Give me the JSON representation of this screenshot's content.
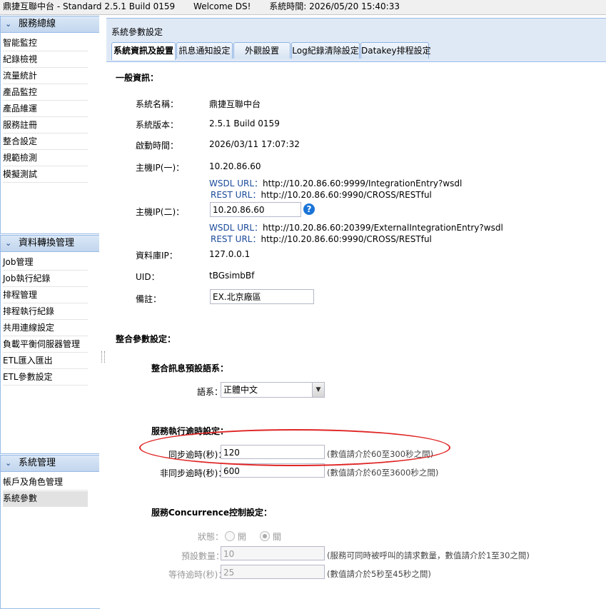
{
  "app": {
    "title": "鼎捷互聯中台 - Standard 2.5.1 Build 0159",
    "welcome": "Welcome DS!",
    "system_time": "系統時間: 2026/05/20 15:40:33"
  },
  "sidebar": {
    "panels": [
      {
        "title": "服務總線",
        "items": [
          "智能監控",
          "紀錄檢視",
          "流量統計",
          "產品監控",
          "產品維運",
          "服務註冊",
          "整合設定",
          "規範檢測",
          "模擬測試"
        ]
      },
      {
        "title": "資料轉換管理",
        "items": [
          "Job管理",
          "Job執行紀錄",
          "排程管理",
          "排程執行紀錄",
          "共用連線設定",
          "負載平衡伺服器管理",
          "ETL匯入匯出",
          "ETL參數設定"
        ]
      },
      {
        "title": "系統管理",
        "items": [
          "帳戶及角色管理",
          "系統參數"
        ],
        "selected": "系統參數"
      }
    ]
  },
  "main": {
    "title": "系統參數設定",
    "tabs": [
      "系統資訊及設置",
      "訊息通知設定",
      "外觀設置",
      "Log紀錄清除設定",
      "Datakey排程設定"
    ],
    "active_tab": "系統資訊及設置"
  },
  "general": {
    "heading": "一般資訊：",
    "system_name_label": "系統名稱：",
    "system_name": "鼎捷互聯中台",
    "version_label": "系統版本：",
    "version": "2.5.1 Build 0159",
    "start_label": "啟動時間：",
    "start_time": "2026/03/11 17:07:32",
    "host1_label": "主機IP(一)：",
    "host1_ip": "10.20.86.60",
    "host1_wsdl_label": "WSDL URL：",
    "host1_wsdl": "http://10.20.86.60:9999/IntegrationEntry?wsdl",
    "host1_rest_label": "REST URL：",
    "host1_rest": "http://10.20.86.60:9990/CROSS/RESTful",
    "host2_label": "主機IP(二)：",
    "host2_ip": "10.20.86.60",
    "host2_wsdl_label": "WSDL URL：",
    "host2_wsdl": "http://10.20.86.60:20399/ExternalIntegrationEntry?wsdl",
    "host2_rest_label": "REST URL：",
    "host2_rest": "http://10.20.86.60:9990/CROSS/RESTful",
    "db_label": "資料庫IP：",
    "db_ip": "127.0.0.1",
    "uid_label": "UID：",
    "uid": "tBGsimbBf",
    "note_label": "備註：",
    "note": "EX.北京廠區",
    "help_glyph": "?"
  },
  "integration": {
    "heading": "整合參數設定：",
    "lang_heading": "整合訊息預設語系：",
    "lang_label": "語系：",
    "lang_value": "正體中文",
    "dropdown_glyph": "▼",
    "timeout_heading": "服務執行逾時設定：",
    "sync_label": "同步逾時(秒)：",
    "sync_value": "120",
    "sync_hint": "(數值請介於60至300秒之間)",
    "async_label": "非同步逾時(秒)：",
    "async_value": "600",
    "async_hint": "(數值請介於60至3600秒之間)",
    "conc_heading": "服務Concurrence控制設定：",
    "status_label": "狀態：",
    "status_on": "開",
    "status_off": "關",
    "status_value": "關",
    "preset_label": "預設數量：",
    "preset_value": "10",
    "preset_hint": "(服務可同時被呼叫的請求數量，數值請介於1至30之間)",
    "wait_label": "等待逾時(秒)：",
    "wait_value": "25",
    "wait_hint": "(數值請介於5秒至45秒之間)"
  },
  "colors": {
    "accent": "#99bbe8",
    "highlight_oval": "#e02525",
    "help": "#1a74d6"
  }
}
